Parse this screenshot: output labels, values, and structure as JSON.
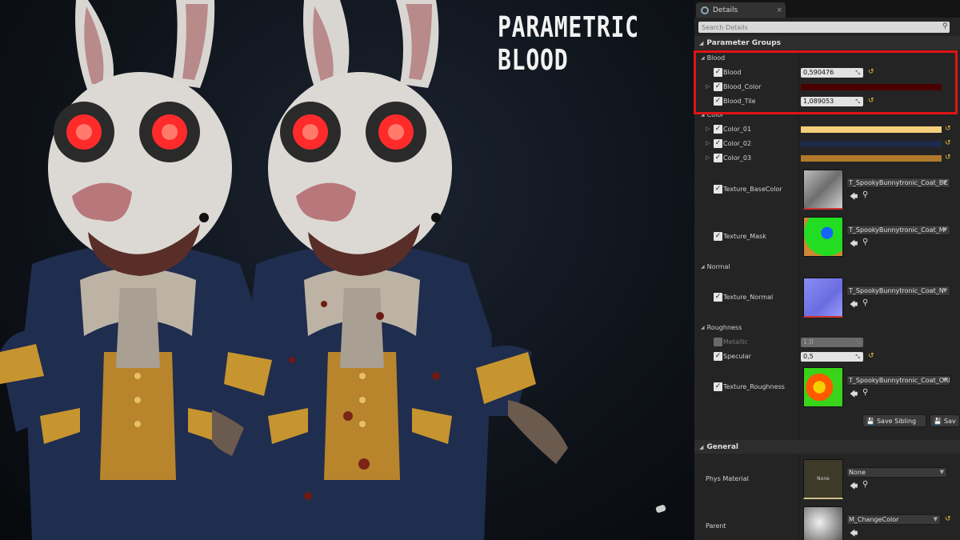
{
  "overlay": {
    "title": "PARAMETRIC BLOOD"
  },
  "tab": {
    "label": "Details",
    "close": "×"
  },
  "search": {
    "placeholder": "Search Details"
  },
  "categories": {
    "parameter_groups": "Parameter Groups",
    "general": "General"
  },
  "groups": {
    "blood": "Blood",
    "color": "Color",
    "normal": "Normal",
    "roughness": "Roughness"
  },
  "params": {
    "blood": {
      "label": "Blood",
      "value": "0,590476"
    },
    "blood_color": {
      "label": "Blood_Color",
      "color": "#4a0000"
    },
    "blood_tile": {
      "label": "Blood_Tile",
      "value": "1,089053"
    },
    "color_01": {
      "label": "Color_01",
      "color": "#f5cf7a"
    },
    "color_02": {
      "label": "Color_02",
      "color": "#1e2a4a"
    },
    "color_03": {
      "label": "Color_03",
      "color": "#b07a2a"
    },
    "texture_basecolor": {
      "label": "Texture_BaseColor",
      "asset": "T_SpookyBunnytronic_Coat_BC"
    },
    "texture_mask": {
      "label": "Texture_Mask",
      "asset": "T_SpookyBunnytronic_Coat_M"
    },
    "texture_normal": {
      "label": "Texture_Normal",
      "asset": "T_SpookyBunnytronic_Coat_N"
    },
    "metallic": {
      "label": "Metallic",
      "value": "1,0"
    },
    "specular": {
      "label": "Specular",
      "value": "0,5"
    },
    "texture_roughness": {
      "label": "Texture_Roughness",
      "asset": "T_SpookyBunnytronic_Coat_ORM"
    }
  },
  "buttons": {
    "save_sibling": "Save Sibling",
    "save_child": "Sav"
  },
  "general": {
    "phys_material": {
      "label": "Phys Material",
      "thumb_text": "None",
      "value": "None"
    },
    "parent": {
      "label": "Parent",
      "value": "M_ChangeColor"
    }
  },
  "colors": {
    "highlight": "#e01414",
    "reset_arrow": "#e8c33a"
  }
}
